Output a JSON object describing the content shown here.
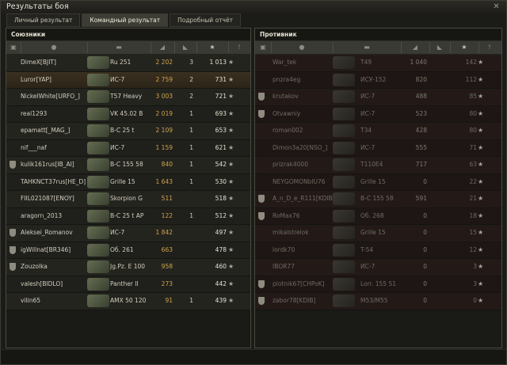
{
  "window": {
    "title": "Результаты боя",
    "close_icon": "close-icon"
  },
  "tabs": [
    "Личный результат",
    "Командный результат",
    "Подробный отчёт"
  ],
  "active_tab": 1,
  "allies": {
    "title": "Союзники",
    "header_icons": [
      "clan-icon",
      "player-icon",
      "tank-icon",
      "damage-icon",
      "kills-icon",
      "xp-star-icon",
      "info-icon"
    ],
    "rows": [
      {
        "name": "DimeX[BJIT]",
        "tank": "Ru 251",
        "damage": "2 202",
        "kills": "3",
        "xp": "1 013",
        "clan_badge": false,
        "self": false
      },
      {
        "name": "Luror[YAP]",
        "tank": "ИС-7",
        "damage": "2 759",
        "kills": "2",
        "xp": "731",
        "clan_badge": false,
        "self": true
      },
      {
        "name": "NickelWhite[URFO_]",
        "tank": "T57 Heavy",
        "damage": "3 003",
        "kills": "2",
        "xp": "721",
        "clan_badge": false,
        "self": false
      },
      {
        "name": "real1293",
        "tank": "VK 45.02 B",
        "damage": "2 019",
        "kills": "1",
        "xp": "693",
        "clan_badge": false,
        "self": false
      },
      {
        "name": "epamatt[_MAG_]",
        "tank": "B-C 25 t",
        "damage": "2 109",
        "kills": "1",
        "xp": "653",
        "clan_badge": false,
        "self": false
      },
      {
        "name": "nif___naf",
        "tank": "ИС-7",
        "damage": "1 159",
        "kills": "1",
        "xp": "621",
        "clan_badge": false,
        "self": false
      },
      {
        "name": "kulik161rus[IB_AI]",
        "tank": "B-C 155 58",
        "damage": "840",
        "kills": "1",
        "xp": "542",
        "clan_badge": true,
        "self": false
      },
      {
        "name": "TAHKNCT37rus[HE_D]",
        "tank": "Grille 15",
        "damage": "1 643",
        "kills": "1",
        "xp": "530",
        "clan_badge": false,
        "self": false
      },
      {
        "name": "FIIL021087[ENOY]",
        "tank": "Skorpion G",
        "damage": "511",
        "kills": "",
        "xp": "518",
        "clan_badge": false,
        "self": false
      },
      {
        "name": "aragorn_2013",
        "tank": "B-C 25 t AP",
        "damage": "122",
        "kills": "1",
        "xp": "512",
        "clan_badge": false,
        "self": false
      },
      {
        "name": "Aleksei_Romanov",
        "tank": "ИС-7",
        "damage": "1 842",
        "kills": "",
        "xp": "497",
        "clan_badge": true,
        "self": false
      },
      {
        "name": "igWillnat[BR346]",
        "tank": "Об. 261",
        "damage": "663",
        "kills": "",
        "xp": "478",
        "clan_badge": true,
        "self": false
      },
      {
        "name": "Zouzolka",
        "tank": "Jg.Pz. E 100",
        "damage": "958",
        "kills": "",
        "xp": "460",
        "clan_badge": true,
        "self": false
      },
      {
        "name": "valesh[BIDLO]",
        "tank": "Panther II",
        "damage": "273",
        "kills": "",
        "xp": "442",
        "clan_badge": false,
        "self": false
      },
      {
        "name": "vilin65",
        "tank": "AMX 50 120",
        "damage": "91",
        "kills": "1",
        "xp": "439",
        "clan_badge": false,
        "self": false
      }
    ]
  },
  "enemies": {
    "title": "Противник",
    "header_icons": [
      "clan-icon",
      "player-icon",
      "tank-icon",
      "damage-icon",
      "kills-icon",
      "xp-star-icon",
      "info-icon"
    ],
    "rows": [
      {
        "name": "War_tek",
        "tank": "T49",
        "damage": "1 040",
        "kills": "",
        "xp": "142",
        "clan_badge": false
      },
      {
        "name": "pnzra4eg",
        "tank": "ИСУ-152",
        "damage": "820",
        "kills": "",
        "xp": "112",
        "clan_badge": false
      },
      {
        "name": "krutakov",
        "tank": "ИС-7",
        "damage": "488",
        "kills": "",
        "xp": "85",
        "clan_badge": true
      },
      {
        "name": "Otvawniy",
        "tank": "ИС-7",
        "damage": "523",
        "kills": "",
        "xp": "80",
        "clan_badge": true
      },
      {
        "name": "roman002",
        "tank": "T34",
        "damage": "428",
        "kills": "",
        "xp": "80",
        "clan_badge": false
      },
      {
        "name": "Dimon3a20[NSO_]",
        "tank": "ИС-7",
        "damage": "555",
        "kills": "",
        "xp": "71",
        "clan_badge": false
      },
      {
        "name": "prizrak4000",
        "tank": "T110E4",
        "damage": "717",
        "kills": "",
        "xp": "63",
        "clan_badge": false
      },
      {
        "name": "NEYGOMONblU76",
        "tank": "Grille 15",
        "damage": "0",
        "kills": "",
        "xp": "22",
        "clan_badge": false
      },
      {
        "name": "A_n_D_e_R111[KDIB]",
        "tank": "B-C 155 58",
        "damage": "591",
        "kills": "",
        "xp": "21",
        "clan_badge": true
      },
      {
        "name": "RoMax76",
        "tank": "Об. 268",
        "damage": "0",
        "kills": "",
        "xp": "18",
        "clan_badge": true
      },
      {
        "name": "mikalstrelok",
        "tank": "Grille 15",
        "damage": "0",
        "kills": "",
        "xp": "15",
        "clan_badge": false
      },
      {
        "name": "lordk70",
        "tank": "T-54",
        "damage": "0",
        "kills": "",
        "xp": "12",
        "clan_badge": false
      },
      {
        "name": "IBOR77",
        "tank": "ИС-7",
        "damage": "0",
        "kills": "",
        "xp": "3",
        "clan_badge": false
      },
      {
        "name": "plotnik67[CHPoK]",
        "tank": "Lorr. 155 51",
        "damage": "0",
        "kills": "",
        "xp": "3",
        "clan_badge": true
      },
      {
        "name": "zabor78[KDIB]",
        "tank": "M53/M55",
        "damage": "0",
        "kills": "",
        "xp": "0",
        "clan_badge": true
      }
    ]
  }
}
